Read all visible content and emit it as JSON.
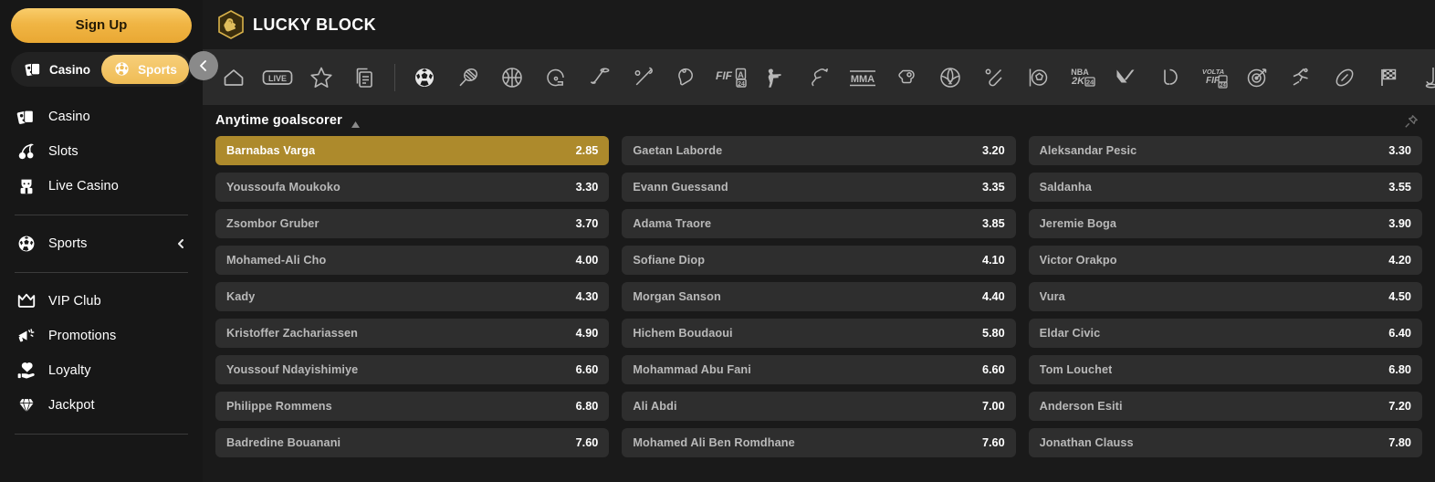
{
  "sidebar": {
    "signup_label": "Sign Up",
    "segments": [
      {
        "label": "Casino",
        "icon": "cards-icon",
        "active": false
      },
      {
        "label": "Sports",
        "icon": "ball-icon",
        "active": true
      }
    ],
    "group1": [
      {
        "label": "Casino",
        "icon": "cards-icon"
      },
      {
        "label": "Slots",
        "icon": "cherry-icon"
      },
      {
        "label": "Live Casino",
        "icon": "dealer-icon"
      }
    ],
    "group2": [
      {
        "label": "Sports",
        "icon": "ball-icon",
        "chevron": "chevron-left-icon"
      }
    ],
    "group3": [
      {
        "label": "VIP Club",
        "icon": "crown-icon"
      },
      {
        "label": "Promotions",
        "icon": "megaphone-icon"
      },
      {
        "label": "Loyalty",
        "icon": "heart-hand-icon"
      },
      {
        "label": "Jackpot",
        "icon": "diamond-icon"
      }
    ]
  },
  "header": {
    "brand": "LUCKY BLOCK",
    "logo_icon": "lucky-block-hexagon-logo"
  },
  "sports_bar": {
    "collapse_icon": "chevron-left-icon",
    "icons": [
      "home-icon",
      "live-icon",
      "star-icon",
      "documents-icon",
      "separator",
      "soccer-icon",
      "tennis-icon",
      "basketball-icon",
      "american-football-helmet-icon",
      "ice-hockey-icon",
      "baseball-icon",
      "table-tennis-icon",
      "fifa-24-icon",
      "counter-strike-icon",
      "horse-racing-icon",
      "mma-icon",
      "boxing-icon",
      "volleyball-icon",
      "cricket-icon",
      "rocket-league-icon",
      "nba-2k24-icon",
      "valorant-icon",
      "league-of-legends-icon",
      "volta-fifa-24-icon",
      "darts-icon",
      "athletics-icon",
      "rugby-icon",
      "motorsport-flag-icon",
      "golf-icon"
    ]
  },
  "market": {
    "title": "Anytime goalscorer",
    "collapse_icon": "caret-up-icon",
    "pin_icon": "pin-icon",
    "columns": [
      [
        {
          "name": "Barnabas Varga",
          "odds": "2.85",
          "selected": true
        },
        {
          "name": "Youssoufa Moukoko",
          "odds": "3.30",
          "selected": false
        },
        {
          "name": "Zsombor Gruber",
          "odds": "3.70",
          "selected": false
        },
        {
          "name": "Mohamed-Ali Cho",
          "odds": "4.00",
          "selected": false
        },
        {
          "name": "Kady",
          "odds": "4.30",
          "selected": false
        },
        {
          "name": "Kristoffer Zachariassen",
          "odds": "4.90",
          "selected": false
        },
        {
          "name": "Youssouf Ndayishimiye",
          "odds": "6.60",
          "selected": false
        },
        {
          "name": "Philippe Rommens",
          "odds": "6.80",
          "selected": false
        },
        {
          "name": "Badredine Bouanani",
          "odds": "7.60",
          "selected": false
        }
      ],
      [
        {
          "name": "Gaetan Laborde",
          "odds": "3.20",
          "selected": false
        },
        {
          "name": "Evann Guessand",
          "odds": "3.35",
          "selected": false
        },
        {
          "name": "Adama Traore",
          "odds": "3.85",
          "selected": false
        },
        {
          "name": "Sofiane Diop",
          "odds": "4.10",
          "selected": false
        },
        {
          "name": "Morgan Sanson",
          "odds": "4.40",
          "selected": false
        },
        {
          "name": "Hichem Boudaoui",
          "odds": "5.80",
          "selected": false
        },
        {
          "name": "Mohammad Abu Fani",
          "odds": "6.60",
          "selected": false
        },
        {
          "name": "Ali Abdi",
          "odds": "7.00",
          "selected": false
        },
        {
          "name": "Mohamed Ali Ben Romdhane",
          "odds": "7.60",
          "selected": false
        }
      ],
      [
        {
          "name": "Aleksandar Pesic",
          "odds": "3.30",
          "selected": false
        },
        {
          "name": "Saldanha",
          "odds": "3.55",
          "selected": false
        },
        {
          "name": "Jeremie Boga",
          "odds": "3.90",
          "selected": false
        },
        {
          "name": "Victor Orakpo",
          "odds": "4.20",
          "selected": false
        },
        {
          "name": "Vura",
          "odds": "4.50",
          "selected": false
        },
        {
          "name": "Eldar Civic",
          "odds": "6.40",
          "selected": false
        },
        {
          "name": "Tom Louchet",
          "odds": "6.80",
          "selected": false
        },
        {
          "name": "Anderson Esiti",
          "odds": "7.20",
          "selected": false
        },
        {
          "name": "Jonathan Clauss",
          "odds": "7.80",
          "selected": false
        }
      ]
    ]
  },
  "colors": {
    "accent_gold": "#efbc55",
    "selected_row": "#ad8a2c",
    "row_bg": "#2e2e2e",
    "sidebar_bg": "#171717",
    "page_bg": "#1a1a1a",
    "sports_bar_bg": "#2b2b2b"
  }
}
